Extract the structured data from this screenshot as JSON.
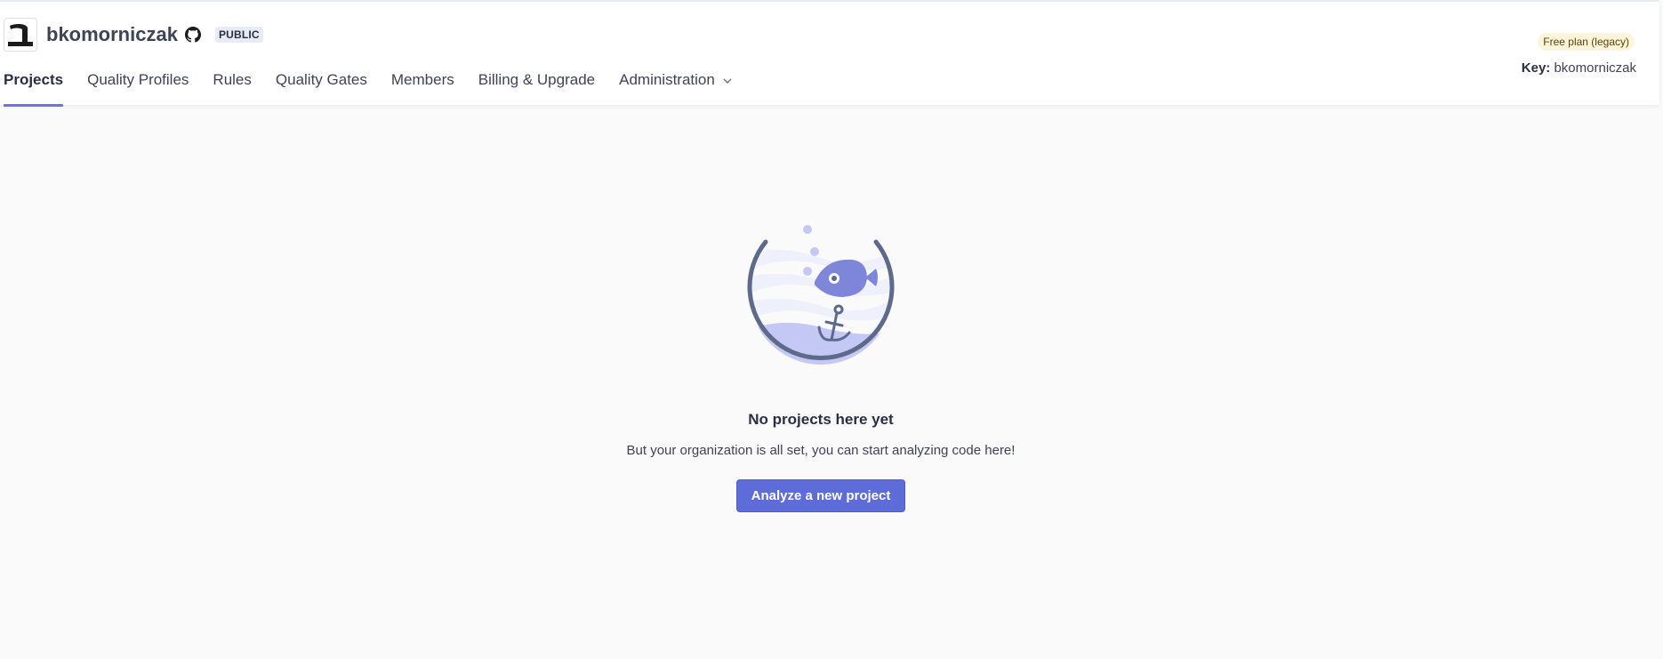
{
  "org": {
    "name": "bkomorniczak",
    "visibility_badge": "PUBLIC",
    "avatar_icon": "hebrew-bet-logo",
    "provider_icon": "github-icon"
  },
  "nav": {
    "items": [
      {
        "label": "Projects",
        "active": true
      },
      {
        "label": "Quality Profiles",
        "active": false
      },
      {
        "label": "Rules",
        "active": false
      },
      {
        "label": "Quality Gates",
        "active": false
      },
      {
        "label": "Members",
        "active": false
      },
      {
        "label": "Billing & Upgrade",
        "active": false
      },
      {
        "label": "Administration",
        "active": false,
        "has_dropdown": true
      }
    ]
  },
  "plan": {
    "label": "Free plan (legacy)",
    "key_label": "Key:",
    "key_value": "bkomorniczak"
  },
  "empty_state": {
    "title": "No projects here yet",
    "subtitle": "But your organization is all set, you can start analyzing code here!",
    "cta_label": "Analyze a new project",
    "illustration": "fishbowl-with-fish-and-anchor"
  },
  "colors": {
    "accent": "#5d6cd8",
    "active_tab_underline": "#6b73e6",
    "plan_pill_bg": "#fdf4dc"
  }
}
